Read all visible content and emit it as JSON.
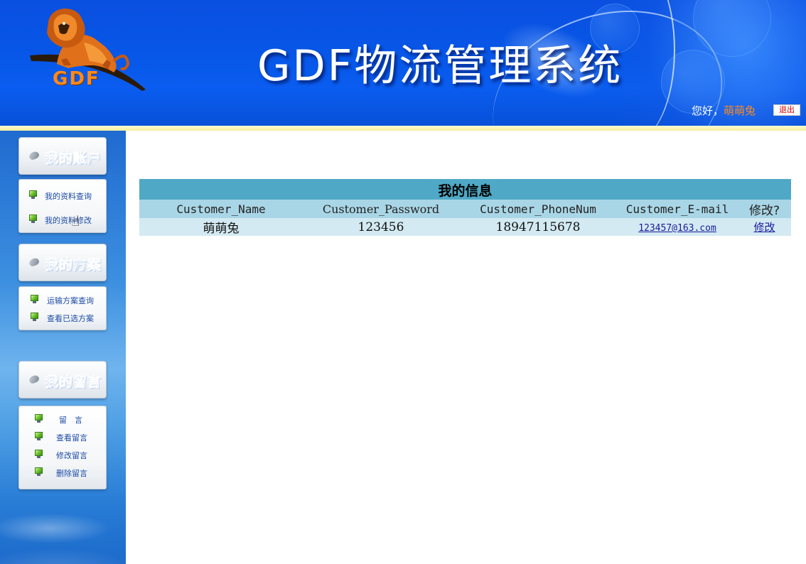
{
  "header": {
    "logo_text": "GDF",
    "title": "GDF物流管理系统",
    "greeting": "您好，",
    "username": "萌萌兔",
    "logout_label": "退出",
    "colors": {
      "header_blue": "#0757e8",
      "accent_orange": "#ff8a1c",
      "stripe_yellow": "#f6ee9c"
    }
  },
  "sidebar": {
    "sections": [
      {
        "title": "我的账户",
        "icon": "mouse-icon",
        "items": [
          {
            "label": "我的资料查询",
            "icon": "monitor-icon"
          },
          {
            "label": "我的资料修改",
            "icon": "monitor-icon"
          }
        ]
      },
      {
        "title": "我的方案",
        "icon": "mouse-icon",
        "items": [
          {
            "label": "运输方案查询",
            "icon": "monitor-icon"
          },
          {
            "label": "查看已选方案",
            "icon": "monitor-icon"
          }
        ]
      },
      {
        "title": "我的留言",
        "icon": "mouse-icon",
        "items": [
          {
            "label": "留　言",
            "icon": "monitor-icon"
          },
          {
            "label": "查看留言",
            "icon": "monitor-icon"
          },
          {
            "label": "修改留言",
            "icon": "monitor-icon"
          },
          {
            "label": "删除留言",
            "icon": "monitor-icon"
          }
        ]
      }
    ]
  },
  "info": {
    "title": "我的信息",
    "columns": [
      "Customer_Name",
      "Customer_Password",
      "Customer_PhoneNum",
      "Customer_E-mail",
      "修改?"
    ],
    "row": {
      "name": "萌萌兔",
      "password": "123456",
      "phone": "18947115678",
      "email": "123457@163.com",
      "edit_link": "修改"
    },
    "colors": {
      "title_bg": "#4fa9c6",
      "header_bg": "#a9d6e6",
      "row_bg": "#d3eaf2"
    }
  },
  "cursor": {
    "icon": "hand-pointer-icon"
  }
}
